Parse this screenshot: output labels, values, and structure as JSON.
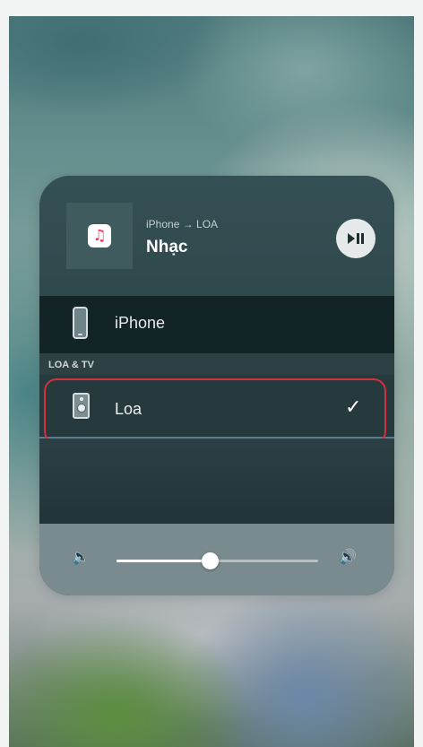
{
  "now_playing": {
    "route": "iPhone → LOA",
    "track": "Nhạc",
    "app_icon": "music-app-icon",
    "play_pause_icon": "▶❚❚"
  },
  "devices": {
    "iphone": {
      "label": "iPhone",
      "icon": "iphone-icon"
    },
    "section_header": "LOA & TV",
    "loa": {
      "label": "Loa",
      "icon": "speaker-icon",
      "selected": true,
      "check": "✓"
    }
  },
  "volume": {
    "level": 0.46,
    "min_icon": "🔈",
    "max_icon": "🔊"
  },
  "colors": {
    "highlight": "#d1323f",
    "panel": "#24373c"
  }
}
